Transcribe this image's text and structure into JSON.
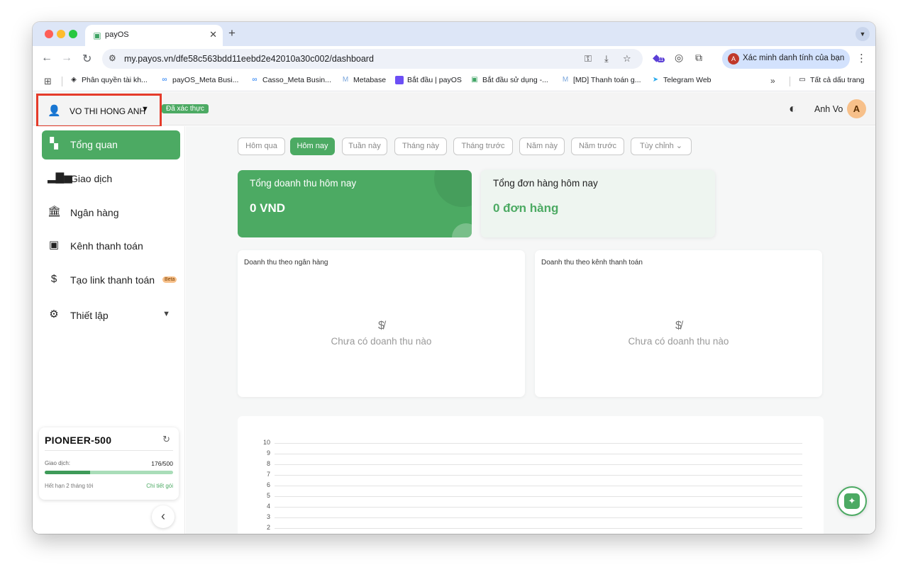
{
  "browser": {
    "tab_title": "payOS",
    "tab_close": "✕",
    "new_tab": "+",
    "url": "my.payos.vn/dfe58c563bdd11eebd2e42010a30c002/dashboard",
    "profile_label": "Xác minh danh tính của bạn",
    "profile_initial": "A",
    "extension_badge": "11"
  },
  "bookmarks": {
    "items": [
      {
        "label": "Phân quyền tài kh...",
        "icon": "layers-icon"
      },
      {
        "label": "payOS_Meta Busi...",
        "icon": "meta-icon"
      },
      {
        "label": "Casso_Meta Busin...",
        "icon": "meta-icon"
      },
      {
        "label": "Metabase",
        "icon": "metabase-icon"
      },
      {
        "label": "Bắt đầu | payOS",
        "icon": "payos-square-icon"
      },
      {
        "label": "Bắt đầu sử dụng -...",
        "icon": "payos-icon"
      },
      {
        "label": "[MD] Thanh toán g...",
        "icon": "metabase-icon"
      },
      {
        "label": "Telegram Web",
        "icon": "telegram-icon"
      }
    ],
    "more": "»",
    "all_bookmarks": "Tất cả dấu trang"
  },
  "header": {
    "account_name": "VO THI HONG ANH",
    "verified": "Đã xác thực",
    "user_name": "Anh Vo",
    "user_initial": "A"
  },
  "sidebar": {
    "items": [
      {
        "label": "Tổng quan",
        "icon": "dashboard-icon",
        "active": true
      },
      {
        "label": "Giao dịch",
        "icon": "bar-chart-icon",
        "active": false
      },
      {
        "label": "Ngân hàng",
        "icon": "bank-icon",
        "active": false
      },
      {
        "label": "Kênh thanh toán",
        "icon": "wallet-icon",
        "active": false
      },
      {
        "label": "Tạo link thanh toán",
        "icon": "invoice-icon",
        "active": false,
        "badge": "Beta"
      },
      {
        "label": "Thiết lập",
        "icon": "gear-icon",
        "active": false
      }
    ],
    "plan": {
      "name": "PIONEER-500",
      "tx_label": "Giao dịch:",
      "tx_count": "176/500",
      "usage_fraction": 0.352,
      "expiry": "Hết hạn 2 tháng tới",
      "detail_link": "Chi tiết gói"
    }
  },
  "filters": {
    "items": [
      "Hôm qua",
      "Hôm nay",
      "Tuần này",
      "Tháng này",
      "Tháng trước",
      "Năm này",
      "Năm trước",
      "Tùy chỉnh"
    ],
    "selected": "Hôm nay"
  },
  "kpis": {
    "revenue_title": "Tổng doanh thu hôm nay",
    "revenue_value": "0  VND",
    "orders_title": "Tổng đơn hàng hôm nay",
    "orders_value": "0 đơn hàng"
  },
  "panels": {
    "bank_title": "Doanh thu theo ngân hàng",
    "channel_title": "Doanh thu theo kênh thanh toán",
    "empty_text": "Chưa có doanh thu nào"
  },
  "chart": {
    "y_ticks": [
      "10",
      "9",
      "8",
      "7",
      "6",
      "5",
      "4",
      "3",
      "2"
    ]
  },
  "colors": {
    "brand": "#4caa63",
    "highlight": "#e53b2a"
  }
}
